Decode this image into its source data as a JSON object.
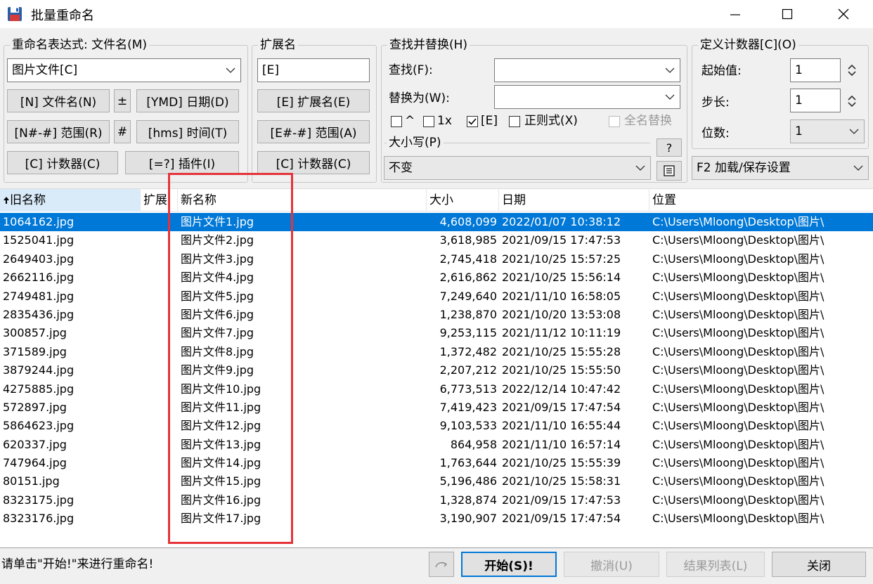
{
  "window": {
    "title": "批量重命名"
  },
  "name_group": {
    "title": "重命名表达式: 文件名(M)",
    "expression": "图片文件[C]",
    "btn_filename": "[N] 文件名(N)",
    "btn_plusminus": "±",
    "btn_date": "[YMD] 日期(D)",
    "btn_range": "[N#-#] 范围(R)",
    "btn_hash": "#",
    "btn_time": "[hms] 时间(T)",
    "btn_counter": "[C] 计数器(C)",
    "btn_plugin": "[=?] 插件(I)"
  },
  "ext_group": {
    "title": "扩展名",
    "value": "[E]",
    "btn_ext": "[E] 扩展名(E)",
    "btn_range": "[E#-#] 范围(A)",
    "btn_counter": "[C] 计数器(C)"
  },
  "replace_group": {
    "title": "查找并替换(H)",
    "find_label": "查找(F):",
    "find_value": "",
    "replace_label": "替换为(W):",
    "replace_value": "",
    "opt_caret": "^",
    "opt_1x": "1x",
    "opt_e": "[E]",
    "opt_regex": "正则式(X)",
    "opt_fullname": "全名替换",
    "case_title": "大小写(P)",
    "case_value": "不变",
    "help_label": "?"
  },
  "counter_group": {
    "title": "定义计数器[C](O)",
    "start_label": "起始值:",
    "start_value": "1",
    "step_label": "步长:",
    "step_value": "1",
    "digits_label": "位数:",
    "digits_value": "1",
    "settings_label": "F2 加载/保存设置"
  },
  "list": {
    "columns": {
      "old": "旧名称",
      "ext": "扩展",
      "new": "新名称",
      "size": "大小",
      "date": "日期",
      "location": "位置"
    },
    "rows": [
      {
        "old": "1064162.jpg",
        "new": "图片文件1.jpg",
        "size": "4,608,099",
        "date": "2022/01/07 10:38:12",
        "location": "C:\\Users\\Mloong\\Desktop\\图片\\"
      },
      {
        "old": "1525041.jpg",
        "new": "图片文件2.jpg",
        "size": "3,618,985",
        "date": "2021/09/15 17:47:53",
        "location": "C:\\Users\\Mloong\\Desktop\\图片\\"
      },
      {
        "old": "2649403.jpg",
        "new": "图片文件3.jpg",
        "size": "2,745,418",
        "date": "2021/10/25 15:57:25",
        "location": "C:\\Users\\Mloong\\Desktop\\图片\\"
      },
      {
        "old": "2662116.jpg",
        "new": "图片文件4.jpg",
        "size": "2,616,862",
        "date": "2021/10/25 15:56:14",
        "location": "C:\\Users\\Mloong\\Desktop\\图片\\"
      },
      {
        "old": "2749481.jpg",
        "new": "图片文件5.jpg",
        "size": "7,249,640",
        "date": "2021/11/10 16:58:05",
        "location": "C:\\Users\\Mloong\\Desktop\\图片\\"
      },
      {
        "old": "2835436.jpg",
        "new": "图片文件6.jpg",
        "size": "1,238,870",
        "date": "2021/10/20 13:53:08",
        "location": "C:\\Users\\Mloong\\Desktop\\图片\\"
      },
      {
        "old": "300857.jpg",
        "new": "图片文件7.jpg",
        "size": "9,253,115",
        "date": "2021/11/12 10:11:19",
        "location": "C:\\Users\\Mloong\\Desktop\\图片\\"
      },
      {
        "old": "371589.jpg",
        "new": "图片文件8.jpg",
        "size": "1,372,482",
        "date": "2021/10/25 15:55:28",
        "location": "C:\\Users\\Mloong\\Desktop\\图片\\"
      },
      {
        "old": "3879244.jpg",
        "new": "图片文件9.jpg",
        "size": "2,207,212",
        "date": "2021/10/25 15:55:50",
        "location": "C:\\Users\\Mloong\\Desktop\\图片\\"
      },
      {
        "old": "4275885.jpg",
        "new": "图片文件10.jpg",
        "size": "6,773,513",
        "date": "2022/12/14 10:47:42",
        "location": "C:\\Users\\Mloong\\Desktop\\图片\\"
      },
      {
        "old": "572897.jpg",
        "new": "图片文件11.jpg",
        "size": "7,419,423",
        "date": "2021/09/15 17:47:54",
        "location": "C:\\Users\\Mloong\\Desktop\\图片\\"
      },
      {
        "old": "5864623.jpg",
        "new": "图片文件12.jpg",
        "size": "9,103,533",
        "date": "2021/11/10 16:55:44",
        "location": "C:\\Users\\Mloong\\Desktop\\图片\\"
      },
      {
        "old": "620337.jpg",
        "new": "图片文件13.jpg",
        "size": "864,958",
        "date": "2021/11/10 16:57:14",
        "location": "C:\\Users\\Mloong\\Desktop\\图片\\"
      },
      {
        "old": "747964.jpg",
        "new": "图片文件14.jpg",
        "size": "1,763,644",
        "date": "2021/10/25 15:55:39",
        "location": "C:\\Users\\Mloong\\Desktop\\图片\\"
      },
      {
        "old": "80151.jpg",
        "new": "图片文件15.jpg",
        "size": "5,196,486",
        "date": "2021/10/25 15:58:31",
        "location": "C:\\Users\\Mloong\\Desktop\\图片\\"
      },
      {
        "old": "8323175.jpg",
        "new": "图片文件16.jpg",
        "size": "1,328,874",
        "date": "2021/09/15 17:47:53",
        "location": "C:\\Users\\Mloong\\Desktop\\图片\\"
      },
      {
        "old": "8323176.jpg",
        "new": "图片文件17.jpg",
        "size": "3,190,907",
        "date": "2021/09/15 17:47:54",
        "location": "C:\\Users\\Mloong\\Desktop\\图片\\"
      }
    ]
  },
  "status": {
    "message": "请单击\"开始!\"来进行重命名!",
    "start_label": "开始(S)!",
    "undo_label": "撤消(U)",
    "results_label": "结果列表(L)",
    "close_label": "关闭"
  }
}
